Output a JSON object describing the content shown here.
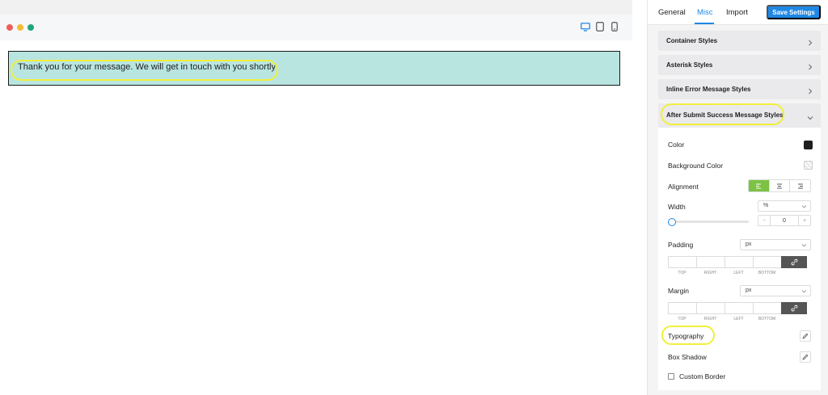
{
  "preview": {
    "success_message": "Thank you for your message. We will get in touch with you shortly",
    "device_icons": [
      "desktop-icon",
      "tablet-icon",
      "mobile-icon"
    ]
  },
  "tabs": [
    {
      "label": "General",
      "active": false
    },
    {
      "label": "Misc",
      "active": true
    },
    {
      "label": "Import",
      "active": false
    }
  ],
  "save_button": "Save Settings",
  "accordions": [
    {
      "label": "Container Styles",
      "expanded": false
    },
    {
      "label": "Asterisk Styles",
      "expanded": false
    },
    {
      "label": "Inline Error Message Styles",
      "expanded": false
    },
    {
      "label": "After Submit Success Message Styles",
      "expanded": true
    }
  ],
  "success_styles": {
    "color_label": "Color",
    "color_value": "#1e1e1e",
    "background_label": "Background Color",
    "alignment_label": "Alignment",
    "alignment_selected": "left",
    "width_label": "Width",
    "width_unit": "%",
    "width_value": "0",
    "stepper_minus": "−",
    "stepper_plus": "+",
    "padding_label": "Padding",
    "padding_unit": "px",
    "margin_label": "Margin",
    "margin_unit": "px",
    "dim_labels": [
      "TOP",
      "RIGHT",
      "LEFT",
      "BOTTOM"
    ],
    "typography_label": "Typography",
    "box_shadow_label": "Box Shadow",
    "custom_border_label": "Custom Border"
  },
  "colors": {
    "accent": "#1e88e5",
    "success_bg": "#b9e5e1",
    "align_active": "#7cc243",
    "highlight": "#f1ef3b"
  }
}
